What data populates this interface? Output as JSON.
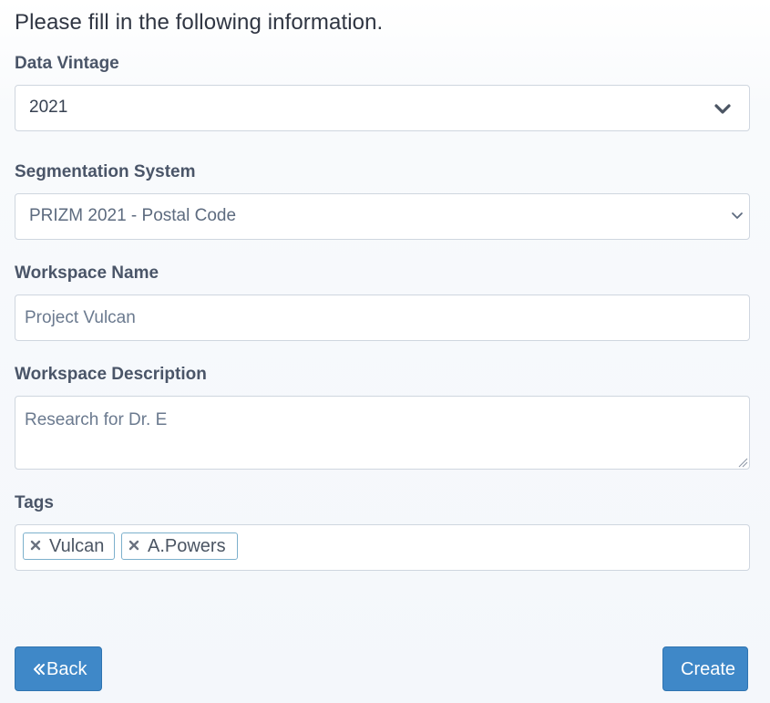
{
  "intro": "Please fill in the following information.",
  "vintage": {
    "label": "Data Vintage",
    "value": "2021",
    "icon": "chevron-down-icon"
  },
  "segmentation": {
    "label": "Segmentation System",
    "value": "PRIZM 2021 - Postal Code",
    "icon": "chevron-down-icon"
  },
  "workspace_name": {
    "label": "Workspace Name",
    "value": "Project Vulcan"
  },
  "workspace_description": {
    "label": "Workspace Description",
    "value": "Research for Dr. E"
  },
  "tags": {
    "label": "Tags",
    "items": [
      {
        "label": "Vulcan",
        "remove_icon": "close-icon"
      },
      {
        "label": "A.Powers",
        "remove_icon": "close-icon"
      }
    ]
  },
  "buttons": {
    "back_label": "Back",
    "back_icon": "double-chevron-left-icon",
    "create_label": "Create"
  },
  "colors": {
    "primary_button": "#3f88c8",
    "tag_border": "#7cb0cc",
    "label_text": "#4a5568"
  }
}
